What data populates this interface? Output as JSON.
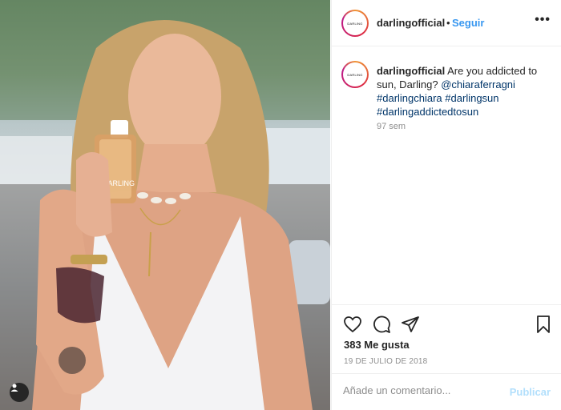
{
  "post": {
    "account": {
      "username": "darlingofficial",
      "avatar_text": "DARLING"
    },
    "header": {
      "separator": "•",
      "follow_label": "Seguir",
      "more_label": "•••"
    },
    "caption": {
      "username": "darlingofficial",
      "text": "Are you addicted to sun, Darling?",
      "mention": "@chiaraferragni",
      "hashtags": [
        "#darlingchiara",
        "#darlingsun",
        "#darlingaddictedtosun"
      ],
      "time": "97 sem"
    },
    "actions": {
      "icons": [
        "heart-icon",
        "comment-icon",
        "share-icon",
        "bookmark-icon"
      ]
    },
    "likes": "383 Me gusta",
    "date": "19 DE JULIO DE 2018",
    "comment": {
      "placeholder": "Añade un comentario...",
      "post_label": "Publicar"
    },
    "photo": {
      "bottle_label": "DARLING"
    }
  },
  "colors": {
    "link": "#003569",
    "follow": "#3897f0",
    "muted": "#8e8e8e",
    "post_disabled": "#b2dffc"
  }
}
